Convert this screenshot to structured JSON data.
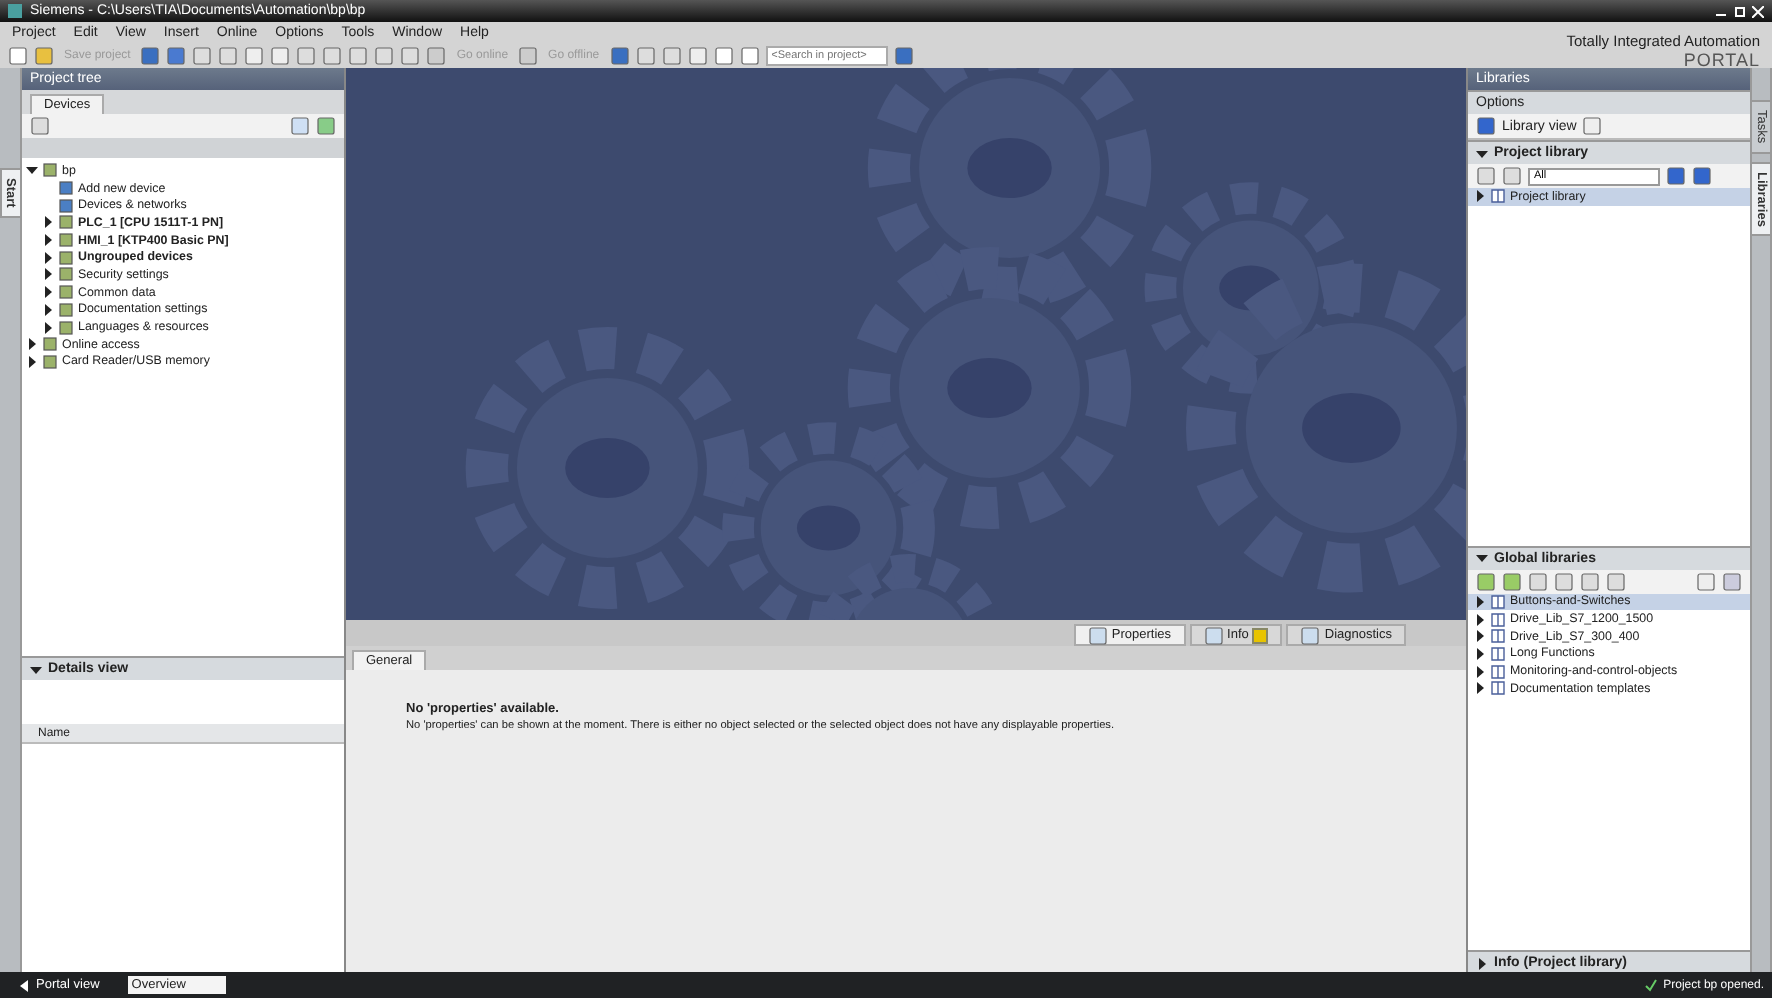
{
  "window": {
    "title": "Siemens  -  C:\\Users\\TIA\\Documents\\Automation\\bp\\bp"
  },
  "menu": [
    "Project",
    "Edit",
    "View",
    "Insert",
    "Online",
    "Options",
    "Tools",
    "Window",
    "Help"
  ],
  "toolbar": {
    "buttons": [
      {
        "label": "Save project",
        "disabled": true
      },
      {
        "label": "Go online",
        "disabled": true
      },
      {
        "label": "Go offline",
        "disabled": true
      }
    ],
    "search": {
      "placeholder": "<Search in project>"
    }
  },
  "branding": {
    "line1": "Totally Integrated Automation",
    "line2": "PORTAL"
  },
  "start_tab": {
    "label": "Start"
  },
  "project_tree": {
    "title": "Project tree",
    "tabs": [
      {
        "label": "Devices",
        "selected": true
      }
    ],
    "items": [
      {
        "label": "bp",
        "kind": "node",
        "expanded": true,
        "bold": false,
        "children": [
          {
            "label": "Add new device",
            "kind": "leaf",
            "bold": false
          },
          {
            "label": "Devices & networks",
            "kind": "leaf",
            "bold": false
          },
          {
            "label": "PLC_1 [CPU 1511T-1 PN]",
            "kind": "node",
            "expanded": false,
            "bold": true
          },
          {
            "label": "HMI_1 [KTP400 Basic PN]",
            "kind": "node",
            "expanded": false,
            "bold": true
          },
          {
            "label": "Ungrouped devices",
            "kind": "node",
            "expanded": false,
            "bold": true
          },
          {
            "label": "Security settings",
            "kind": "node",
            "expanded": false,
            "bold": false
          },
          {
            "label": "Common data",
            "kind": "node",
            "expanded": false,
            "bold": false
          },
          {
            "label": "Documentation settings",
            "kind": "node",
            "expanded": false,
            "bold": false
          },
          {
            "label": "Languages & resources",
            "kind": "node",
            "expanded": false,
            "bold": false
          }
        ]
      },
      {
        "label": "Online access",
        "kind": "node",
        "expanded": false,
        "bold": false
      },
      {
        "label": "Card Reader/USB memory",
        "kind": "node",
        "expanded": false,
        "bold": false
      }
    ]
  },
  "details_view": {
    "title": "Details view",
    "expanded": true,
    "columns": [
      "Name"
    ]
  },
  "inspector": {
    "tabs": [
      {
        "label": "Properties",
        "selected": true
      },
      {
        "label": "Info",
        "selected": false
      },
      {
        "label": "Diagnostics",
        "selected": false
      }
    ],
    "subtabs": [
      {
        "label": "General",
        "selected": true
      }
    ],
    "message_title": "No 'properties' available.",
    "message_body": "No 'properties' can be shown at the moment. There is either no object selected or the selected object does not have any displayable properties."
  },
  "libraries": {
    "title": "Libraries",
    "options_label": "Options",
    "library_view_label": "Library view",
    "project_library": {
      "title": "Project library",
      "expanded": true,
      "filter": "All",
      "items": [
        {
          "label": "Project library",
          "selected": true
        }
      ]
    },
    "global_libraries": {
      "title": "Global libraries",
      "expanded": true,
      "items": [
        {
          "label": "Buttons-and-Switches",
          "selected": true
        },
        {
          "label": "Drive_Lib_S7_1200_1500",
          "selected": false
        },
        {
          "label": "Drive_Lib_S7_300_400",
          "selected": false
        },
        {
          "label": "Long Functions",
          "selected": false
        },
        {
          "label": "Monitoring-and-control-objects",
          "selected": false
        },
        {
          "label": "Documentation templates",
          "selected": false
        }
      ]
    },
    "info": {
      "title": "Info (Project library)",
      "expanded": false
    }
  },
  "side_tabs": [
    {
      "label": "Tasks",
      "selected": false
    },
    {
      "label": "Libraries",
      "selected": true
    }
  ],
  "status_bar": {
    "portal_view": "Portal view",
    "tabs": [
      {
        "label": "Overview",
        "selected": true
      }
    ],
    "message": "Project bp opened."
  }
}
